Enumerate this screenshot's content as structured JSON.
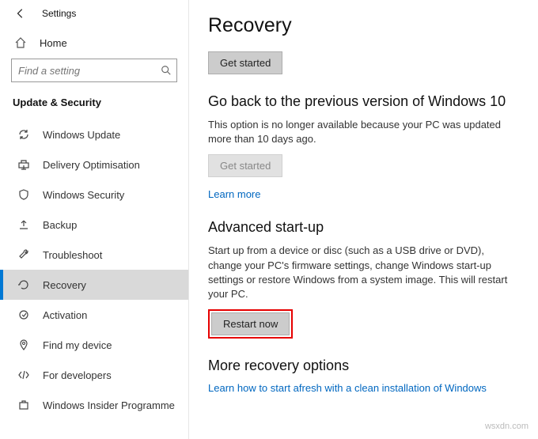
{
  "titlebar": {
    "label": "Settings"
  },
  "sidebar": {
    "home_label": "Home",
    "search_placeholder": "Find a setting",
    "section_label": "Update & Security",
    "items": [
      {
        "label": "Windows Update"
      },
      {
        "label": "Delivery Optimisation"
      },
      {
        "label": "Windows Security"
      },
      {
        "label": "Backup"
      },
      {
        "label": "Troubleshoot"
      },
      {
        "label": "Recovery"
      },
      {
        "label": "Activation"
      },
      {
        "label": "Find my device"
      },
      {
        "label": "For developers"
      },
      {
        "label": "Windows Insider Programme"
      }
    ]
  },
  "main": {
    "title": "Recovery",
    "get_started_label": "Get started",
    "goback": {
      "title": "Go back to the previous version of Windows 10",
      "body": "This option is no longer available because your PC was updated more than 10 days ago.",
      "button": "Get started",
      "learn_more": "Learn more"
    },
    "advanced": {
      "title": "Advanced start-up",
      "body": "Start up from a device or disc (such as a USB drive or DVD), change your PC's firmware settings, change Windows start-up settings or restore Windows from a system image. This will restart your PC.",
      "button": "Restart now"
    },
    "more": {
      "title": "More recovery options",
      "link": "Learn how to start afresh with a clean installation of Windows"
    }
  },
  "watermark": "wsxdn.com"
}
